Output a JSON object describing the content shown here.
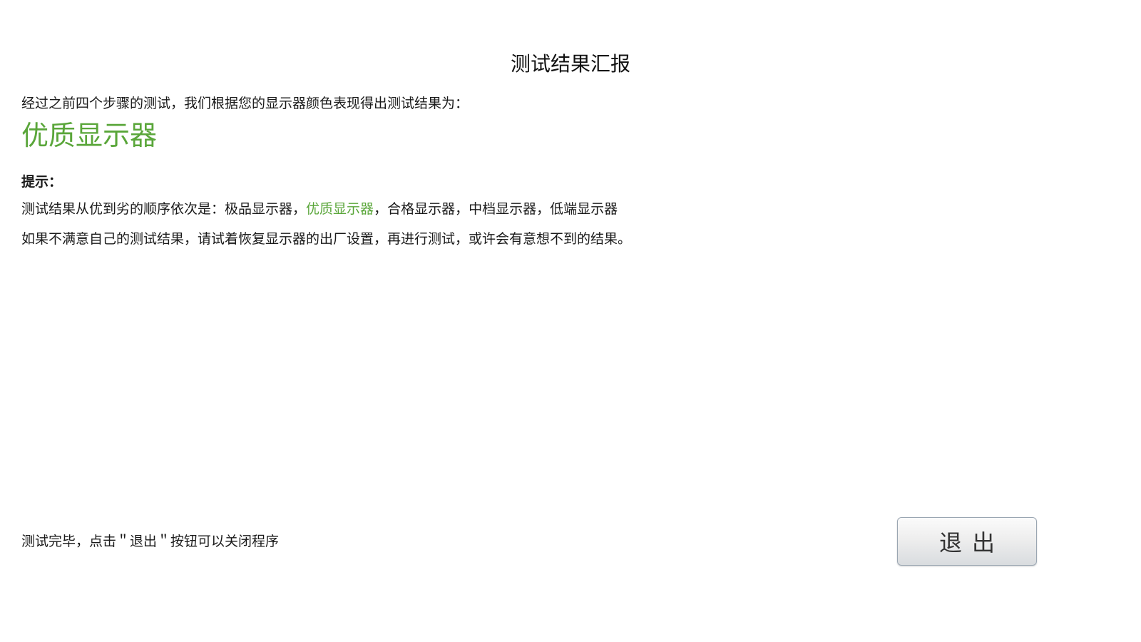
{
  "page": {
    "title": "测试结果汇报"
  },
  "summary": {
    "intro": "经过之前四个步骤的测试，我们根据您的显示器颜色表现得出测试结果为：",
    "result": "优质显示器",
    "result_color": "#5aa63a"
  },
  "tips": {
    "heading": "提示：",
    "order_prefix": "测试结果从优到劣的顺序依次是：",
    "order_items": [
      "极品显示器",
      "优质显示器",
      "合格显示器",
      "中档显示器",
      "低端显示器"
    ],
    "separator": "，",
    "advice": "如果不满意自己的测试结果，请试着恢复显示器的出厂设置，再进行测试，或许会有意想不到的结果。"
  },
  "footer": {
    "note": "测试完毕，点击＂退出＂按钮可以关闭程序",
    "exit_label": "退出"
  }
}
